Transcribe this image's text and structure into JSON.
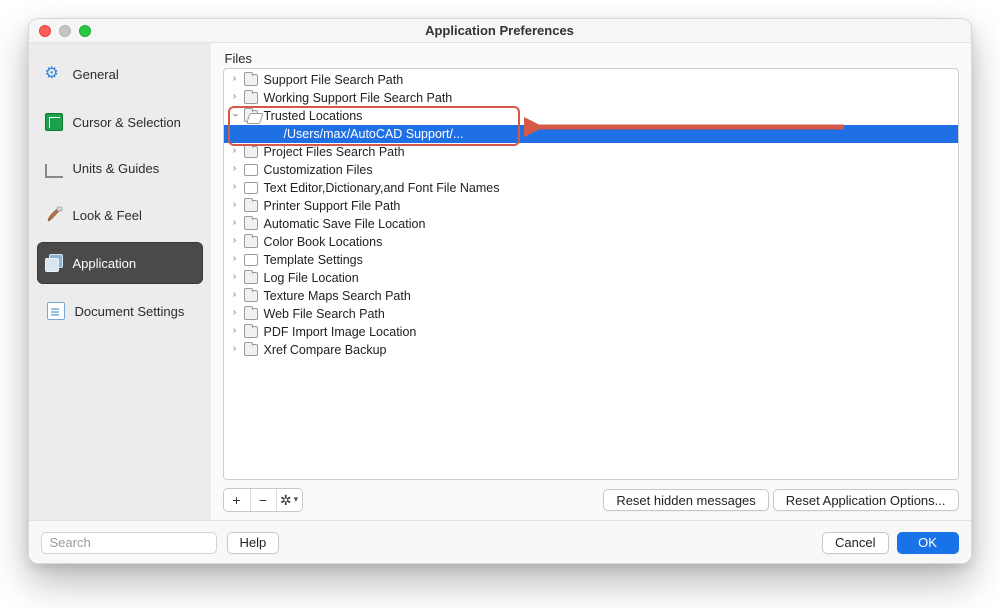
{
  "window": {
    "title": "Application Preferences"
  },
  "sidebar": {
    "items": [
      {
        "label": "General"
      },
      {
        "label": "Cursor & Selection"
      },
      {
        "label": "Units & Guides"
      },
      {
        "label": "Look & Feel"
      },
      {
        "label": "Application"
      },
      {
        "label": "Document Settings"
      }
    ]
  },
  "section": {
    "files_label": "Files"
  },
  "tree": [
    {
      "label": "Support File Search Path",
      "indent": 0,
      "expanded": false,
      "icon": "folder"
    },
    {
      "label": "Working Support File Search Path",
      "indent": 0,
      "expanded": false,
      "icon": "folder"
    },
    {
      "label": "Trusted Locations",
      "indent": 0,
      "expanded": true,
      "icon": "open"
    },
    {
      "label": "/Users/max/AutoCAD Support/...",
      "indent": 1,
      "expanded": null,
      "icon": "none",
      "selected": true
    },
    {
      "label": "Project Files Search Path",
      "indent": 0,
      "expanded": false,
      "icon": "folder"
    },
    {
      "label": "Customization Files",
      "indent": 0,
      "expanded": false,
      "icon": "doc"
    },
    {
      "label": "Text Editor,Dictionary,and Font File Names",
      "indent": 0,
      "expanded": false,
      "icon": "doc"
    },
    {
      "label": "Printer Support File Path",
      "indent": 0,
      "expanded": false,
      "icon": "folder"
    },
    {
      "label": "Automatic Save File Location",
      "indent": 0,
      "expanded": false,
      "icon": "folder"
    },
    {
      "label": "Color Book Locations",
      "indent": 0,
      "expanded": false,
      "icon": "folder"
    },
    {
      "label": "Template Settings",
      "indent": 0,
      "expanded": false,
      "icon": "doc"
    },
    {
      "label": "Log File Location",
      "indent": 0,
      "expanded": false,
      "icon": "folder"
    },
    {
      "label": "Texture Maps Search Path",
      "indent": 0,
      "expanded": false,
      "icon": "folder"
    },
    {
      "label": "Web File Search Path",
      "indent": 0,
      "expanded": false,
      "icon": "folder"
    },
    {
      "label": "PDF Import Image Location",
      "indent": 0,
      "expanded": false,
      "icon": "folder"
    },
    {
      "label": "Xref Compare Backup",
      "indent": 0,
      "expanded": false,
      "icon": "folder"
    }
  ],
  "toolbar": {
    "add": "+",
    "remove": "−",
    "gear": "✲",
    "reset_hidden": "Reset hidden messages",
    "reset_app_options": "Reset Application Options..."
  },
  "footer": {
    "search_placeholder": "Search",
    "help": "Help",
    "cancel": "Cancel",
    "ok": "OK"
  }
}
